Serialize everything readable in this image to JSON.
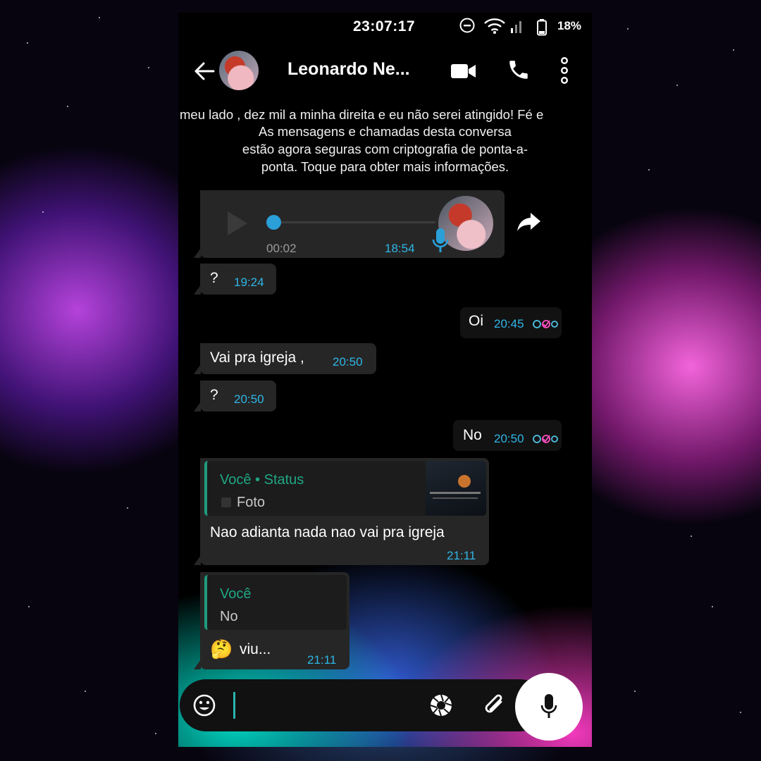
{
  "status_bar": {
    "time": "23:07:17",
    "battery": "18%",
    "icons": [
      "do-not-disturb-icon",
      "wifi-icon",
      "signal-icon",
      "battery-icon"
    ]
  },
  "header": {
    "contact_name": "Leonardo Ne...",
    "icons": [
      "back-arrow-icon",
      "video-call-icon",
      "phone-call-icon",
      "more-options-icon"
    ]
  },
  "chat": {
    "marquee_text": "meu lado , dez mil a minha direita e eu não serei atingido! Fé e",
    "encryption_notice": [
      "As mensagens e chamadas desta conversa",
      "estão agora seguras com criptografia de ponta-a-",
      "ponta. Toque para obter mais informações."
    ],
    "messages": [
      {
        "type": "voice",
        "direction": "in",
        "duration": "00:02",
        "time": "18:54"
      },
      {
        "type": "text",
        "direction": "in",
        "text": "?",
        "time": "19:24"
      },
      {
        "type": "text",
        "direction": "out",
        "text": "Oi",
        "time": "20:45"
      },
      {
        "type": "text",
        "direction": "in",
        "text": "Vai pra igreja ,",
        "time": "20:50"
      },
      {
        "type": "text",
        "direction": "in",
        "text": "?",
        "time": "20:50"
      },
      {
        "type": "text",
        "direction": "out",
        "text": "No",
        "time": "20:50"
      },
      {
        "type": "reply",
        "direction": "in",
        "reply_author": "Você • Status",
        "reply_text": "Foto",
        "text": "Nao adianta nada nao vai pra igreja",
        "time": "21:11"
      },
      {
        "type": "reply",
        "direction": "in",
        "reply_author": "Você",
        "reply_text": "No",
        "emoji": "🤔",
        "text": "viu...",
        "time": "21:11"
      }
    ]
  },
  "input": {
    "icons": [
      "emoji-icon",
      "camera-icon",
      "attach-icon",
      "mic-icon"
    ]
  },
  "colors": {
    "time_blue": "#2fb6e6",
    "reply_green": "#1fa783",
    "bubble_dark": "#262626"
  }
}
